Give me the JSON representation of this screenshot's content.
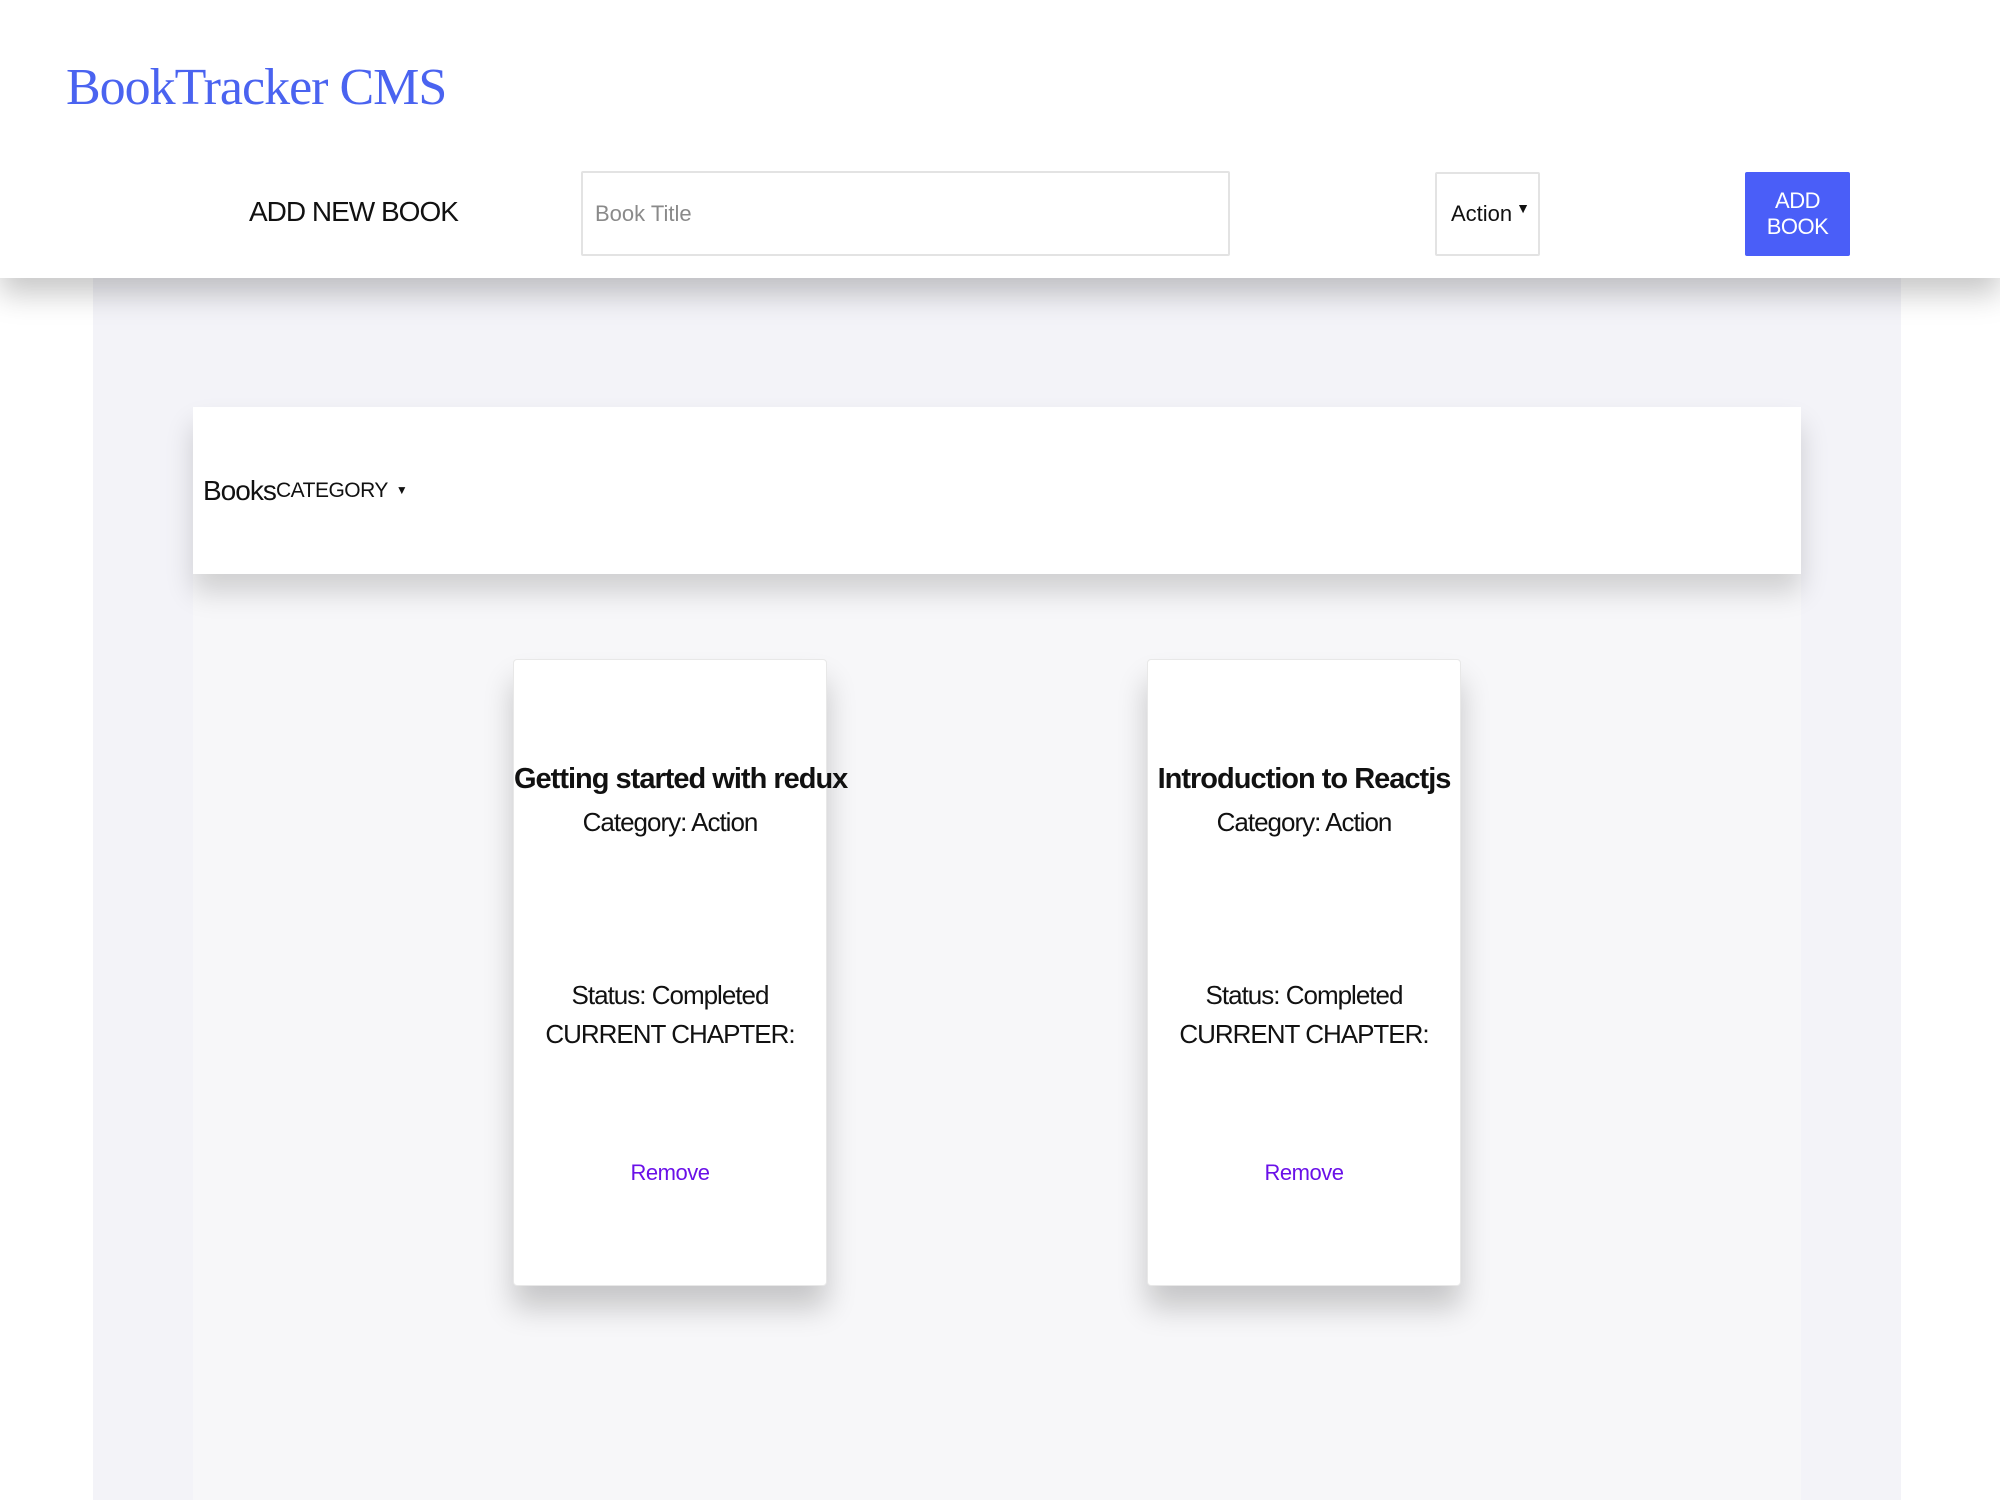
{
  "app": {
    "title": "BookTracker CMS"
  },
  "add_form": {
    "label": "ADD NEW BOOK",
    "title_placeholder": "Book Title",
    "title_value": "",
    "category_selected": "Action",
    "submit_label": "ADD BOOK"
  },
  "toolbar": {
    "books_label": "Books",
    "category_label": "CATEGORY"
  },
  "books": [
    {
      "title": "Getting started with redux",
      "category": "Category: Action",
      "status": "Status: Completed",
      "chapter": "CURRENT CHAPTER:",
      "remove_label": "Remove"
    },
    {
      "title": "Introduction to Reactjs",
      "category": "Category: Action",
      "status": "Status: Completed",
      "chapter": "CURRENT CHAPTER:",
      "remove_label": "Remove"
    }
  ],
  "colors": {
    "brand": "#4a63f0",
    "button": "#4a5ef8",
    "link": "#6a10e8",
    "panel_bg": "#f3f3f8"
  },
  "icons": {
    "select_caret": "caret-down-icon",
    "category_caret": "caret-down-icon"
  }
}
